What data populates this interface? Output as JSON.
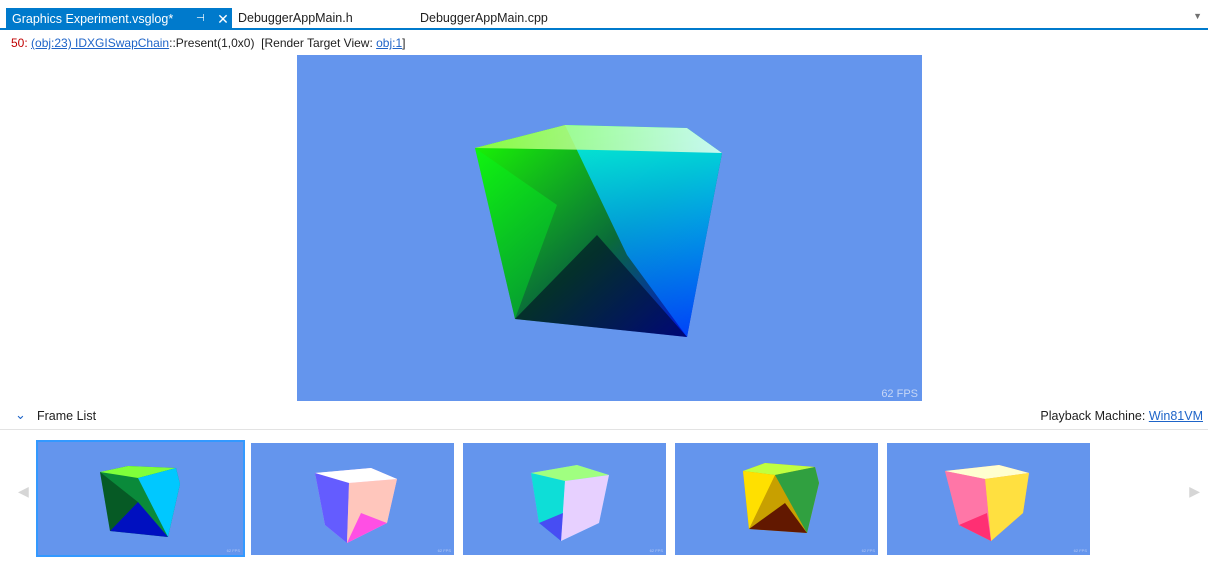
{
  "tabs": [
    {
      "label": "Graphics Experiment.vsglog*",
      "active": true
    },
    {
      "label": "DebuggerAppMain.h",
      "active": false
    },
    {
      "label": "DebuggerAppMain.cpp",
      "active": false
    }
  ],
  "icons": {
    "pin": "pin-icon",
    "close": "close-icon",
    "dropdown": "chevron-down-icon",
    "collapse": "chevron-down-icon",
    "nav_left": "chevron-left-icon",
    "nav_right": "chevron-right-icon"
  },
  "glyphs": {
    "pin": "⊣",
    "close": "✕",
    "dropdown": "▼",
    "collapse": "⌄",
    "left": "◀",
    "right": "▶"
  },
  "header": {
    "event_number": "50:",
    "object_link": "(obj:23) IDXGISwapChain",
    "call": "::Present(1,0x0)",
    "rtv_prefix": "[Render Target View: ",
    "rtv_link": "obj:1",
    "rtv_suffix": "]"
  },
  "viewport": {
    "fps": "62 FPS",
    "background": "#6495ed"
  },
  "frame_list": {
    "label": "Frame List",
    "playback_label": "Playback Machine: ",
    "playback_machine": "Win81VM"
  },
  "thumbnails": [
    {
      "fps": "62 FPS",
      "selected": true
    },
    {
      "fps": "62 FPS",
      "selected": false
    },
    {
      "fps": "62 FPS",
      "selected": false
    },
    {
      "fps": "62 FPS",
      "selected": false
    },
    {
      "fps": "62 FPS",
      "selected": false
    }
  ],
  "colors": {
    "accent": "#007acc",
    "link": "#1e64c8",
    "event_number": "#c00000",
    "viewport_bg": "#6495ed"
  }
}
